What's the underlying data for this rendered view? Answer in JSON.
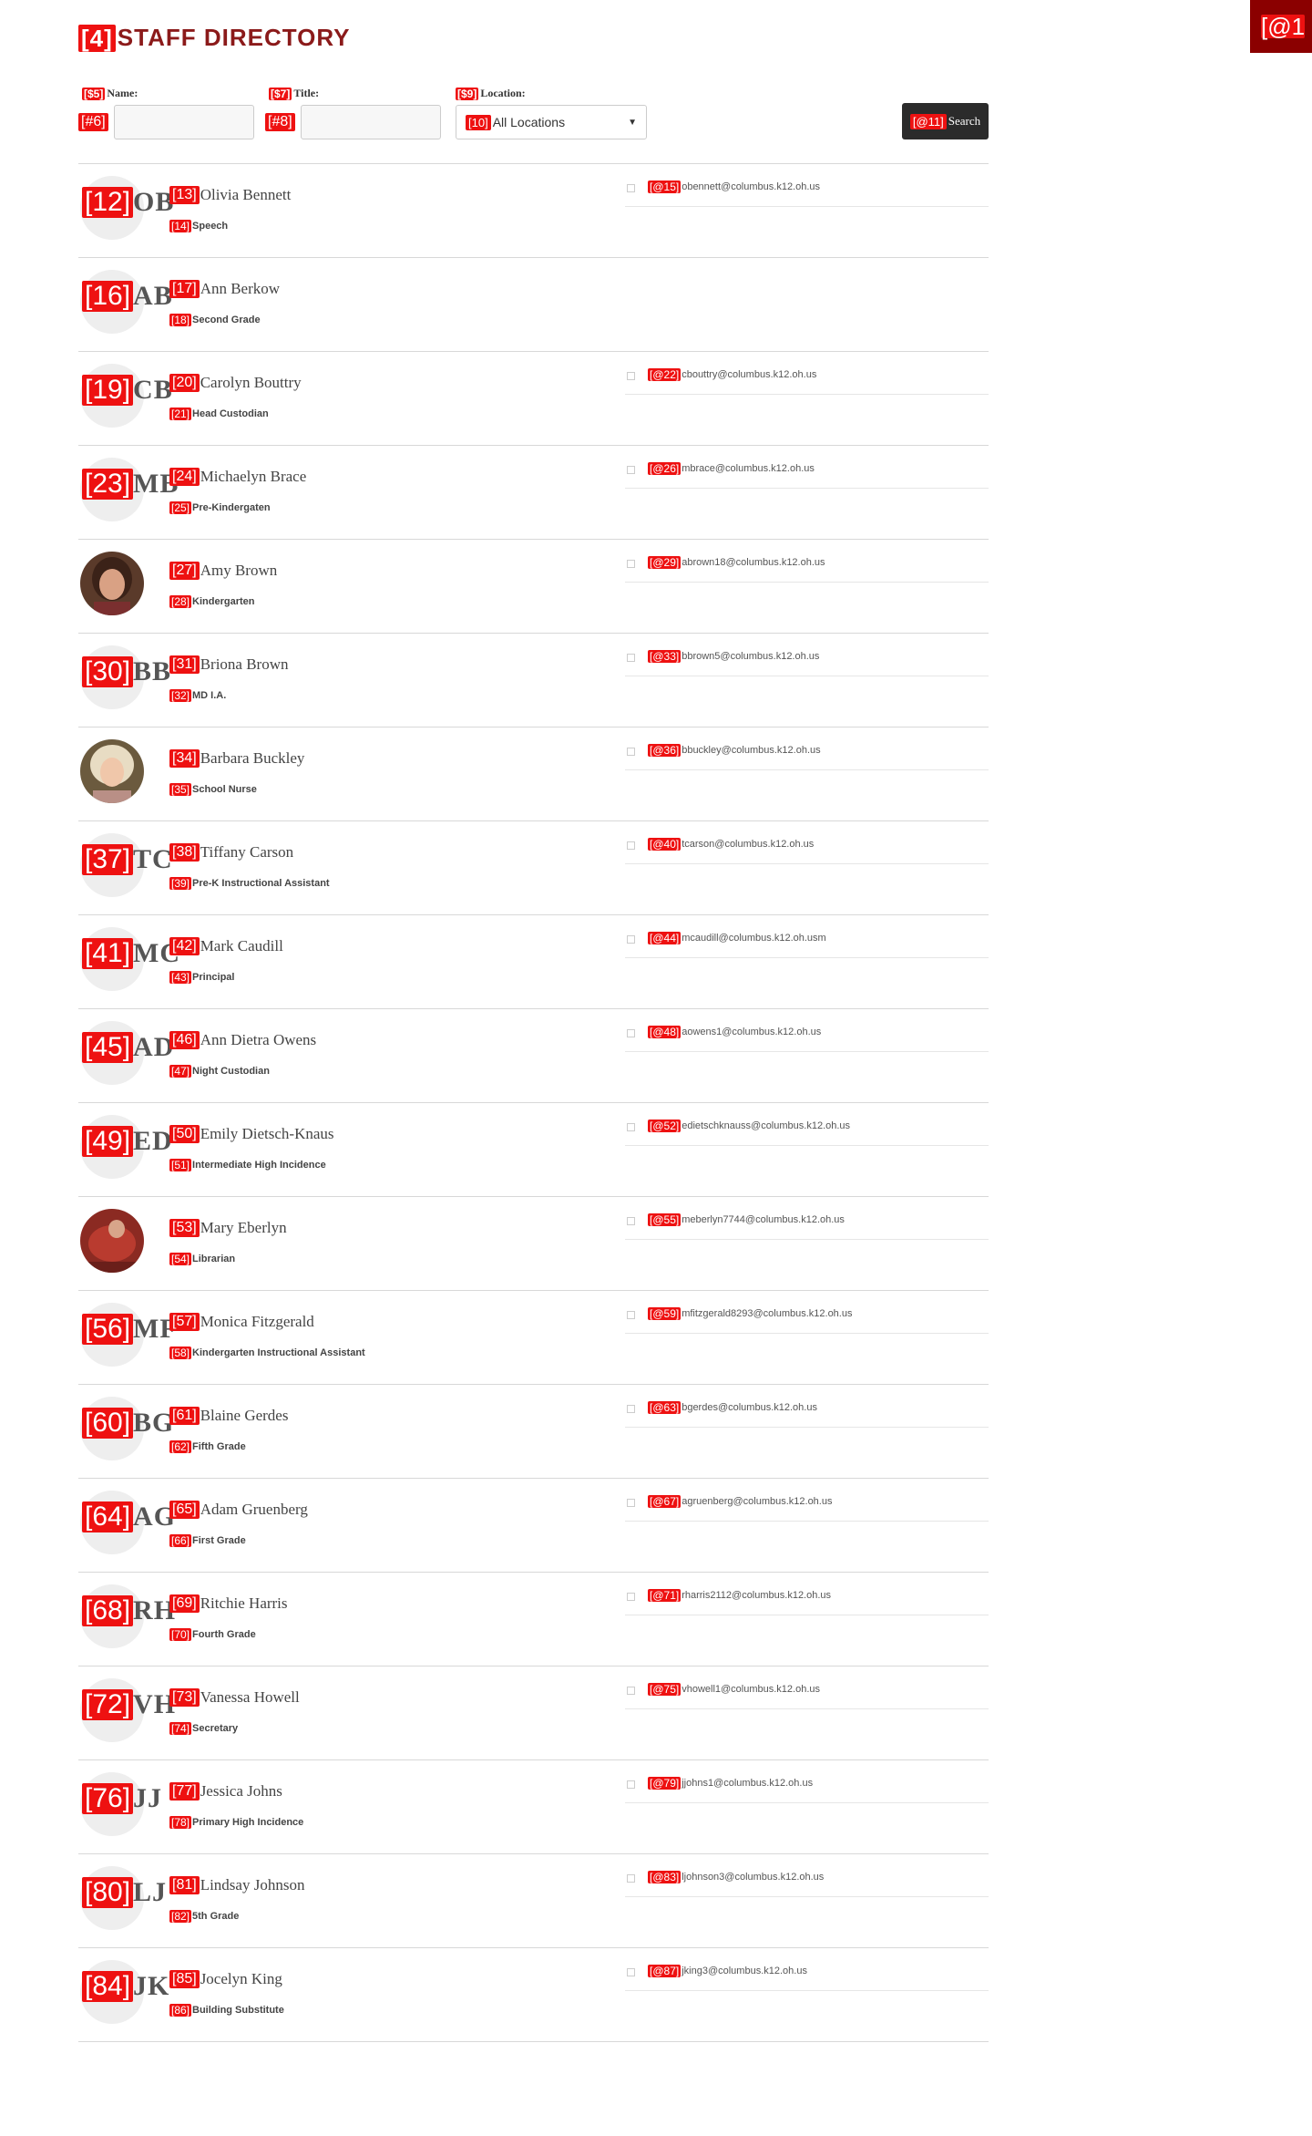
{
  "header": {
    "title_tag": "[4]",
    "title": "STAFF DIRECTORY",
    "corner_tag": "[@1"
  },
  "filters": {
    "name_label_tag": "[$5]",
    "name_label": "Name:",
    "name_input_tag": "[#6]",
    "title_label_tag": "[$7]",
    "title_label": "Title:",
    "title_input_tag": "[#8]",
    "location_label_tag": "[$9]",
    "location_label": "Location:",
    "location_tag": "[10]",
    "location_value": "All Locations",
    "search_tag": "[@11]",
    "search_label": "Search"
  },
  "colors": {
    "title": "#8b1a1a",
    "corner": "#8b0000",
    "marker": "#ee1111",
    "button": "#2b2b2b"
  },
  "staff": [
    {
      "avatar_tag": "[12]",
      "initials": "OB",
      "name_tag": "[13]",
      "name": "Olivia Bennett",
      "title_tag": "[14]",
      "title": "Speech",
      "email_tag": "[@15]",
      "email": "obennett@columbus.k12.oh.us"
    },
    {
      "avatar_tag": "[16]",
      "initials": "AB",
      "name_tag": "[17]",
      "name": "Ann Berkow",
      "title_tag": "[18]",
      "title": "Second Grade",
      "email_tag": "",
      "email": ""
    },
    {
      "avatar_tag": "[19]",
      "initials": "CB",
      "name_tag": "[20]",
      "name": "Carolyn Bouttry",
      "title_tag": "[21]",
      "title": "Head Custodian",
      "email_tag": "[@22]",
      "email": "cbouttry@columbus.k12.oh.us"
    },
    {
      "avatar_tag": "[23]",
      "initials": "MB",
      "name_tag": "[24]",
      "name": "Michaelyn Brace",
      "title_tag": "[25]",
      "title": "Pre-Kindergaten",
      "email_tag": "[@26]",
      "email": "mbrace@columbus.k12.oh.us"
    },
    {
      "avatar_tag": "",
      "initials": "",
      "photo": "photo-a",
      "name_tag": "[27]",
      "name": "Amy Brown",
      "title_tag": "[28]",
      "title": "Kindergarten",
      "email_tag": "[@29]",
      "email": "abrown18@columbus.k12.oh.us"
    },
    {
      "avatar_tag": "[30]",
      "initials": "BB",
      "name_tag": "[31]",
      "name": "Briona Brown",
      "title_tag": "[32]",
      "title": "MD I.A.",
      "email_tag": "[@33]",
      "email": "bbrown5@columbus.k12.oh.us"
    },
    {
      "avatar_tag": "",
      "initials": "",
      "photo": "photo-b",
      "name_tag": "[34]",
      "name": "Barbara Buckley",
      "title_tag": "[35]",
      "title": "School Nurse",
      "email_tag": "[@36]",
      "email": "bbuckley@columbus.k12.oh.us"
    },
    {
      "avatar_tag": "[37]",
      "initials": "TC",
      "name_tag": "[38]",
      "name": "Tiffany Carson",
      "title_tag": "[39]",
      "title": "Pre-K Instructional Assistant",
      "email_tag": "[@40]",
      "email": "tcarson@columbus.k12.oh.us"
    },
    {
      "avatar_tag": "[41]",
      "initials": "MC",
      "name_tag": "[42]",
      "name": "Mark Caudill",
      "title_tag": "[43]",
      "title": "Principal",
      "email_tag": "[@44]",
      "email": "mcaudill@columbus.k12.oh.usm"
    },
    {
      "avatar_tag": "[45]",
      "initials": "AD",
      "name_tag": "[46]",
      "name": "Ann Dietra Owens",
      "title_tag": "[47]",
      "title": "Night Custodian",
      "email_tag": "[@48]",
      "email": "aowens1@columbus.k12.oh.us"
    },
    {
      "avatar_tag": "[49]",
      "initials": "ED",
      "name_tag": "[50]",
      "name": "Emily Dietsch-Knaus",
      "title_tag": "[51]",
      "title": "Intermediate High Incidence",
      "email_tag": "[@52]",
      "email": "edietschknauss@columbus.k12.oh.us"
    },
    {
      "avatar_tag": "",
      "initials": "",
      "photo": "photo-c",
      "name_tag": "[53]",
      "name": "Mary Eberlyn",
      "title_tag": "[54]",
      "title": "Librarian",
      "email_tag": "[@55]",
      "email": "meberlyn7744@columbus.k12.oh.us"
    },
    {
      "avatar_tag": "[56]",
      "initials": "MF",
      "name_tag": "[57]",
      "name": "Monica Fitzgerald",
      "title_tag": "[58]",
      "title": "Kindergarten Instructional Assistant",
      "email_tag": "[@59]",
      "email": "mfitzgerald8293@columbus.k12.oh.us"
    },
    {
      "avatar_tag": "[60]",
      "initials": "BG",
      "name_tag": "[61]",
      "name": "Blaine Gerdes",
      "title_tag": "[62]",
      "title": "Fifth Grade",
      "email_tag": "[@63]",
      "email": "bgerdes@columbus.k12.oh.us"
    },
    {
      "avatar_tag": "[64]",
      "initials": "AG",
      "name_tag": "[65]",
      "name": "Adam Gruenberg",
      "title_tag": "[66]",
      "title": "First Grade",
      "email_tag": "[@67]",
      "email": "agruenberg@columbus.k12.oh.us"
    },
    {
      "avatar_tag": "[68]",
      "initials": "RH",
      "name_tag": "[69]",
      "name": "Ritchie Harris",
      "title_tag": "[70]",
      "title": "Fourth Grade",
      "email_tag": "[@71]",
      "email": "rharris2112@columbus.k12.oh.us"
    },
    {
      "avatar_tag": "[72]",
      "initials": "VH",
      "name_tag": "[73]",
      "name": "Vanessa Howell",
      "title_tag": "[74]",
      "title": "Secretary",
      "email_tag": "[@75]",
      "email": "vhowell1@columbus.k12.oh.us"
    },
    {
      "avatar_tag": "[76]",
      "initials": "JJ",
      "name_tag": "[77]",
      "name": "Jessica Johns",
      "title_tag": "[78]",
      "title": "Primary High Incidence",
      "email_tag": "[@79]",
      "email": "jjohns1@columbus.k12.oh.us"
    },
    {
      "avatar_tag": "[80]",
      "initials": "LJ",
      "name_tag": "[81]",
      "name": "Lindsay Johnson",
      "title_tag": "[82]",
      "title": "5th Grade",
      "email_tag": "[@83]",
      "email": "ljohnson3@columbus.k12.oh.us"
    },
    {
      "avatar_tag": "[84]",
      "initials": "JK",
      "name_tag": "[85]",
      "name": "Jocelyn King",
      "title_tag": "[86]",
      "title": "Building Substitute",
      "email_tag": "[@87]",
      "email": "jking3@columbus.k12.oh.us"
    }
  ]
}
